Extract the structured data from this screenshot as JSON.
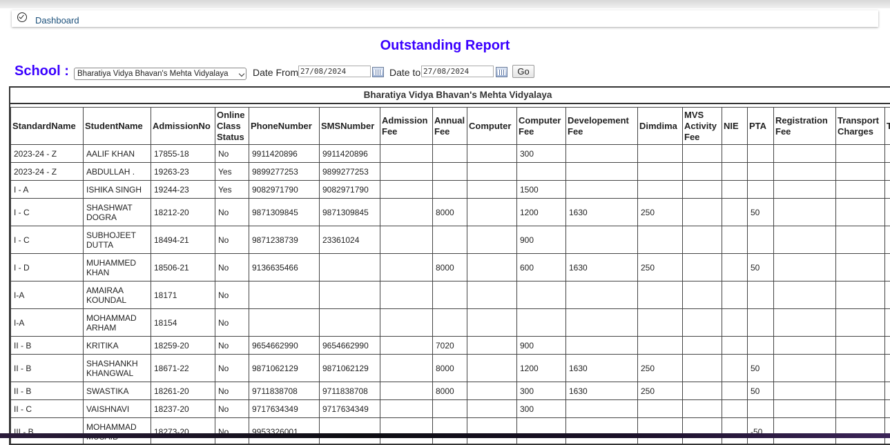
{
  "breadcrumb": {
    "label": "Dashboard"
  },
  "title": "Outstanding Report",
  "filters": {
    "school_label": "School :",
    "school_value": "Bharatiya Vidya Bhavan's Mehta Vidyalaya",
    "date_from_label": "Date From",
    "date_from": "27/08/2024",
    "date_to_label": "Date to",
    "date_to": "27/08/2024",
    "go_label": "Go"
  },
  "report": {
    "school_name": "Bharatiya Vidya Bhavan's Mehta Vidyalaya",
    "columns": [
      "StandardName",
      "StudentName",
      "AdmissionNo",
      "Online Class Status",
      "PhoneNumber",
      "SMSNumber",
      "Admission Fee",
      "Annual Fee",
      "Computer",
      "Computer Fee",
      "Developement Fee",
      "Dimdima",
      "MVS Activity Fee",
      "NIE",
      "PTA",
      "Registration Fee",
      "Transport Charges",
      "T"
    ],
    "rows": [
      [
        "2023-24 - Z",
        "AALIF KHAN",
        "17855-18",
        "No",
        "9911420896",
        "9911420896",
        "",
        "",
        "",
        "300",
        "",
        "",
        "",
        "",
        "",
        "",
        "",
        ""
      ],
      [
        "2023-24 - Z",
        "ABDULLAH .",
        "19263-23",
        "Yes",
        "9899277253",
        "9899277253",
        "",
        "",
        "",
        "",
        "",
        "",
        "",
        "",
        "",
        "",
        "",
        ""
      ],
      [
        "I - A",
        "ISHIKA SINGH",
        "19244-23",
        "Yes",
        "9082971790",
        "9082971790",
        "",
        "",
        "",
        "1500",
        "",
        "",
        "",
        "",
        "",
        "",
        "",
        ""
      ],
      [
        "I - C",
        "SHASHWAT DOGRA",
        "18212-20",
        "No",
        "9871309845",
        "9871309845",
        "",
        "8000",
        "",
        "1200",
        "1630",
        "250",
        "",
        "",
        "50",
        "",
        "",
        ""
      ],
      [
        "I - C",
        "SUBHOJEET DUTTA",
        "18494-21",
        "No",
        "9871238739",
        "23361024",
        "",
        "",
        "",
        "900",
        "",
        "",
        "",
        "",
        "",
        "",
        "",
        ""
      ],
      [
        "I - D",
        "MUHAMMED KHAN",
        "18506-21",
        "No",
        "9136635466",
        "",
        "",
        "8000",
        "",
        "600",
        "1630",
        "250",
        "",
        "",
        "50",
        "",
        "",
        ""
      ],
      [
        "I-A",
        "AMAIRAA KOUNDAL",
        "18171",
        "No",
        "",
        "",
        "",
        "",
        "",
        "",
        "",
        "",
        "",
        "",
        "",
        "",
        "",
        ""
      ],
      [
        "I-A",
        "MOHAMMAD ARHAM",
        "18154",
        "No",
        "",
        "",
        "",
        "",
        "",
        "",
        "",
        "",
        "",
        "",
        "",
        "",
        "",
        ""
      ],
      [
        "II - B",
        "KRITIKA",
        "18259-20",
        "No",
        "9654662990",
        "9654662990",
        "",
        "7020",
        "",
        "900",
        "",
        "",
        "",
        "",
        "",
        "",
        "",
        ""
      ],
      [
        "II - B",
        "SHASHANKH KHANGWAL",
        "18671-22",
        "No",
        "9871062129",
        "9871062129",
        "",
        "8000",
        "",
        "1200",
        "1630",
        "250",
        "",
        "",
        "50",
        "",
        "",
        ""
      ],
      [
        "II - B",
        "SWASTIKA",
        "18261-20",
        "No",
        "9711838708",
        "9711838708",
        "",
        "8000",
        "",
        "300",
        "1630",
        "250",
        "",
        "",
        "50",
        "",
        "",
        ""
      ],
      [
        "II - C",
        "VAISHNAVI",
        "18237-20",
        "No",
        "9717634349",
        "9717634349",
        "",
        "",
        "",
        "300",
        "",
        "",
        "",
        "",
        "",
        "",
        "",
        ""
      ],
      [
        "III - B",
        "MOHAMMAD MUSAIB",
        "18273-20",
        "No",
        "9953326001",
        "",
        "",
        "",
        "",
        "",
        "",
        "",
        "",
        "",
        "-50",
        "",
        "",
        ""
      ]
    ]
  },
  "colors": {
    "title": "#3a00ff",
    "link": "#1a4f7a",
    "border": "#444444"
  },
  "icons": [
    "check-circle-icon",
    "calendar-icon",
    "chevron-down-icon"
  ]
}
